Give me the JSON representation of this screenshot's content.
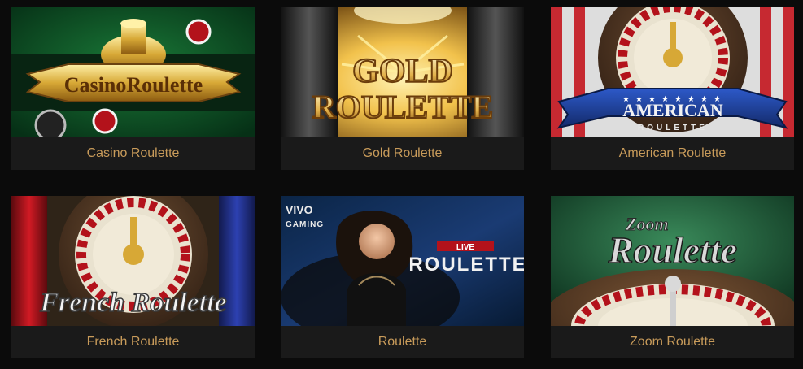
{
  "games": [
    {
      "title": "Casino Roulette",
      "art_text": "CasinoRoulette",
      "colors": {
        "bg": "#0f5a2a",
        "accent": "#d7a836"
      },
      "art_icons": [
        "roulette-trophy-icon",
        "casino-chip-icon"
      ]
    },
    {
      "title": "Gold Roulette",
      "art_text_line1": "GOLD",
      "art_text_line2": "ROULETTE",
      "colors": {
        "bg": "#8a5a15",
        "accent": "#f2c24c"
      },
      "art_icons": [
        "stage-curtain-icon",
        "spotlight-icon"
      ]
    },
    {
      "title": "American Roulette",
      "art_text_line1": "AMERICAN",
      "art_text_line2": "ROULETTE",
      "colors": {
        "bg": "#3b2a1c",
        "accent": "#d9d9d9",
        "banner": "#1f3f8f"
      },
      "art_icons": [
        "roulette-wheel-icon",
        "star-banner-icon"
      ]
    },
    {
      "title": "French Roulette",
      "art_text": "French Roulette",
      "colors": {
        "bg": "#2f2418",
        "accent": "#f3f3f3",
        "curtain_left": "#b3121b",
        "curtain_right": "#2d41b1"
      },
      "art_icons": [
        "roulette-wheel-icon"
      ]
    },
    {
      "title": "Roulette",
      "brand_line1": "VIVO",
      "brand_line2": "GAMING",
      "badge": "LIVE",
      "art_text": "ROULETTE",
      "colors": {
        "bg": "#0b2546",
        "badge": "#b3121b"
      },
      "art_icons": [
        "live-dealer-icon",
        "vivo-gaming-logo-icon"
      ]
    },
    {
      "title": "Zoom Roulette",
      "art_text_line1": "Zoom",
      "art_text_line2": "Roulette",
      "colors": {
        "bg": "#1f5b3a",
        "accent": "#d9d9d9"
      },
      "art_icons": [
        "roulette-wheel-icon"
      ]
    }
  ]
}
